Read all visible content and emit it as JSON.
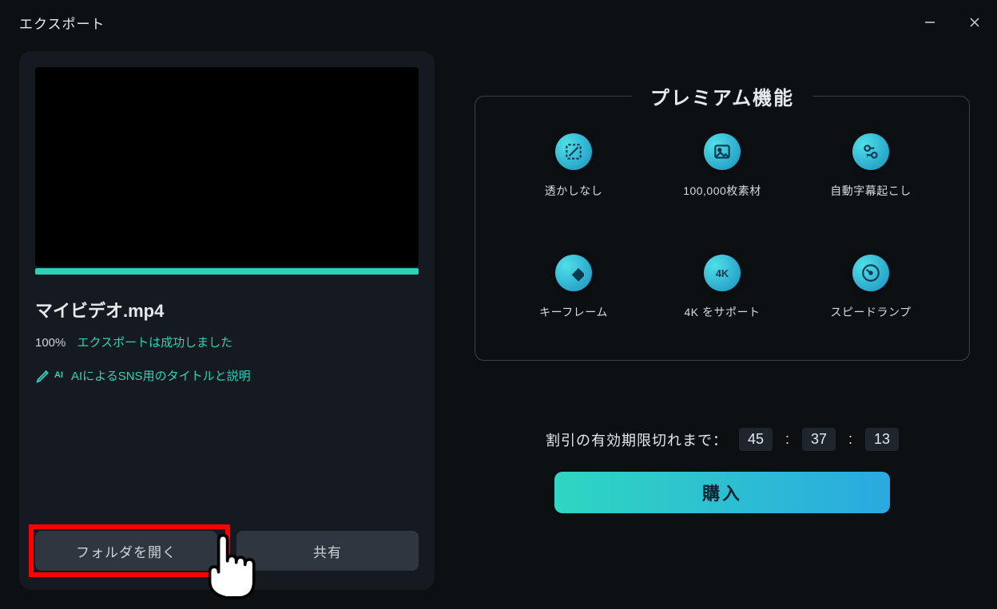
{
  "window": {
    "title": "エクスポート"
  },
  "export": {
    "filename": "マイビデオ.mp4",
    "progress_pct": "100%",
    "status_msg": "エクスポートは成功しました",
    "ai_link_label": "AIによるSNS用のタイトルと説明"
  },
  "actions": {
    "open_folder": "フォルダを開く",
    "share": "共有"
  },
  "premium": {
    "title": "プレミアム機能",
    "features": [
      {
        "label": "透かしなし"
      },
      {
        "label": "100,000枚素材"
      },
      {
        "label": "自動字幕起こし"
      },
      {
        "label": "キーフレーム"
      },
      {
        "label": "4K をサポート"
      },
      {
        "label": "スピードランプ"
      }
    ]
  },
  "offer": {
    "label": "割引の有効期限切れまで：",
    "time": {
      "h": "45",
      "m": "37",
      "s": "13"
    },
    "buy_label": "購入"
  }
}
